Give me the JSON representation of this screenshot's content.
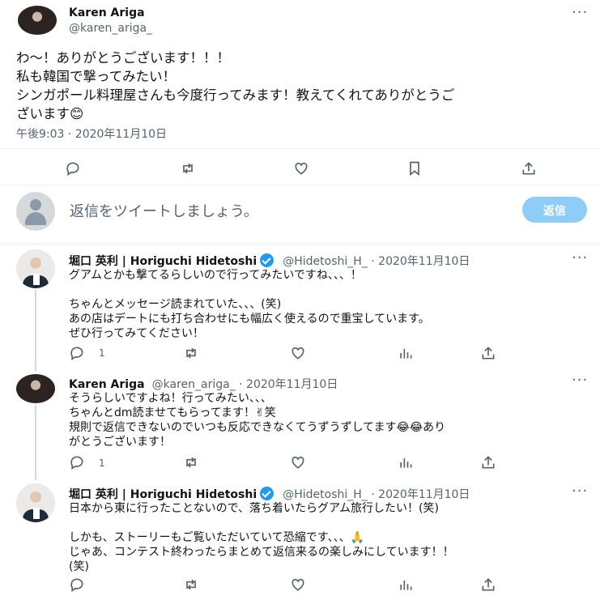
{
  "main_tweet": {
    "display_name": "Karen Ariga",
    "handle": "@karen_ariga_",
    "more": "···",
    "lines": [
      "わ〜！ありがとうございます！！！",
      "私も韓国で撃ってみたい！",
      "シンガポール料理屋さんも今度行ってみます！教えてくれてありがとうご",
      "ざいます😊"
    ],
    "timestamp": "午後9:03 · 2020年11月10日",
    "actions": [
      "reply-icon",
      "retweet-icon",
      "like-icon",
      "bookmark-icon",
      "share-icon"
    ]
  },
  "composer": {
    "placeholder": "返信をツイートしましょう。",
    "button": "返信"
  },
  "replies": [
    {
      "display_name": "堀口 英利 | Horiguchi Hidetoshi",
      "verified": true,
      "handle_date": "@Hidetoshi_H_ · 2020年11月10日",
      "more": "···",
      "text": "グアムとかも撃てるらしいので行ってみたいですね、、、！\n\nちゃんとメッセージ読まれていた、、、(笑)\nあの店はデートにも打ち合わせにも幅広く使えるので重宝しています。\nぜひ行ってみてください！",
      "reply_count": "1"
    },
    {
      "display_name": "Karen Ariga",
      "verified": false,
      "handle_date": "@karen_ariga_ · 2020年11月10日",
      "more": "···",
      "text": "そうらしいですよね！行ってみたい、、、\nちゃんとdm読ませてもらってます！✌笑\n規則で返信できないのでいつも反応できなくてうずうずしてます😂😂あり\nがとうございます！",
      "reply_count": "1"
    },
    {
      "display_name": "堀口 英利 | Horiguchi Hidetoshi",
      "verified": true,
      "handle_date": "@Hidetoshi_H_ · 2020年11月10日",
      "more": "···",
      "text": "日本から東に行ったことないので、落ち着いたらグアム旅行したい！(笑)\n\nしかも、ストーリーもご覧いただいていて恐縮です、、、🙏\nじゃあ、コンテスト終わったらまとめて返信来るの楽しみにしています！！\n(笑)",
      "reply_count": ""
    }
  ],
  "colors": {
    "accent": "#1d9bf0",
    "reply_button_disabled": "#8ecdf8",
    "muted_text": "#536471",
    "thread_line": "#cfd9de"
  }
}
